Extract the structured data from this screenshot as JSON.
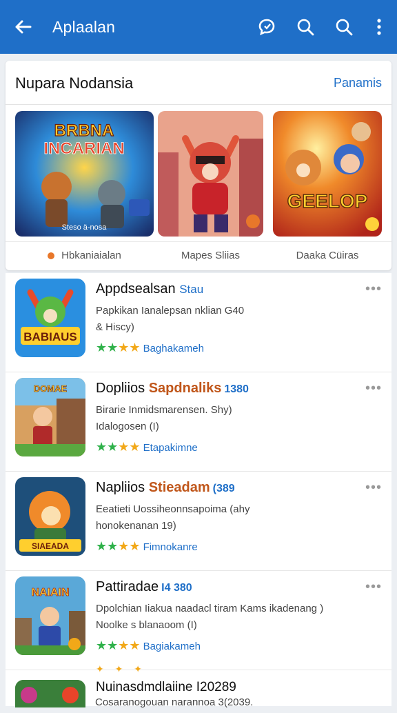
{
  "appbar": {
    "title": "Aplaalan",
    "icons": [
      "back-arrow-icon",
      "chat-bubble-icon",
      "search-icon",
      "search-icon",
      "more-vert-icon"
    ]
  },
  "featured": {
    "title": "Nupara Nodansia",
    "more_label": "Panamis",
    "banners": [
      {
        "label": "Hbkaniaialan",
        "art_text": [
          "BRBNA",
          "INCARIAN"
        ],
        "caption": "Steso ä-nosa"
      },
      {
        "label": "Mapes Sliias"
      },
      {
        "label": "Daaka Cüiras",
        "art_text": [
          "GEELOP"
        ]
      }
    ]
  },
  "apps": [
    {
      "name": "Appdsealsan",
      "accent": "Stau",
      "number": "",
      "desc1": "Papkikan Ianalepsan nklian  G40",
      "desc2": "& Hiscy)",
      "rating_label": "Baghakameh",
      "icon_text": "BABIAUS"
    },
    {
      "name": "Dopliios",
      "accent": "Sapdnaliks",
      "number": "1380",
      "desc1": "Birarie Inmidsmarensen. Shy)",
      "desc2": "Idalogosen  (I)",
      "rating_label": "Etapakimne",
      "icon_text": "DOMAE"
    },
    {
      "name": "Napliios",
      "accent": "Stieadam",
      "number": "(389",
      "desc1": "Eeatieti  Uossiheonnsapoima  (ahy",
      "desc2": "honokenanan 19)",
      "rating_label": "Fimnokanre",
      "icon_text": "SIAEADA"
    },
    {
      "name": "Pattiradae",
      "accent": "",
      "number": "I4 380",
      "desc1": "Dpolchian Iiakua naadacl tiram  Kams ikadenang )",
      "desc2": "Noolke s blanaoom (I)",
      "rating_label": "Bagiakameh",
      "icon_text": "NAIAIN"
    }
  ],
  "partial_item": {
    "title": "Nuinasdmdlaiine I20289",
    "sub": "Cosaranogouan narannoa 3(2039."
  },
  "colors": {
    "primary": "#1f6fc8",
    "star_green": "#2fb14a",
    "star_gold": "#f2a818",
    "accent_orange": "#c0561a"
  }
}
